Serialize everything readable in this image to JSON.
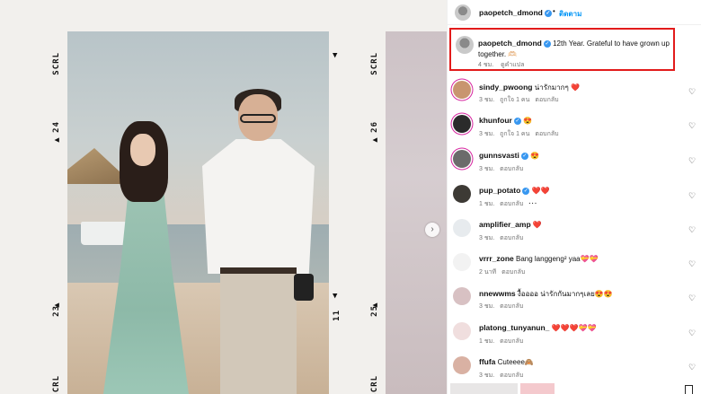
{
  "media": {
    "film_left": {
      "label_top": "SCRL",
      "frame_top": "24",
      "frame_bottom": "23",
      "label_bottom": "SCRL"
    },
    "film_right": {
      "label_top": "SCRL",
      "frame_top": "26",
      "frame_bottom": "25",
      "label_bottom": "SCRL",
      "frame_mid": "11"
    },
    "next_icon": "chevron-right"
  },
  "header": {
    "username": "paopetch_dmond",
    "dot": "•",
    "follow_label": "ติดตาม"
  },
  "caption": {
    "username": "paopetch_dmond",
    "text": "12th Year. Grateful to have grown up together. 🫶🏻",
    "time": "4 ชม.",
    "translate": "ดูคำแปล"
  },
  "comments": [
    {
      "username": "sindy_pwoong",
      "verified": false,
      "text": "น่ารักมากๆ ❤️",
      "time": "3 ชม.",
      "likes": "ถูกใจ 1 คน",
      "reply": "ตอบกลับ",
      "avatar_color": "#c8956f",
      "ring": true
    },
    {
      "username": "khunfour",
      "verified": true,
      "text": "😍",
      "time": "3 ชม.",
      "likes": "ถูกใจ 1 คน",
      "reply": "ตอบกลับ",
      "avatar_color": "#2b2b2b",
      "ring": true
    },
    {
      "username": "gunnsvasti",
      "verified": true,
      "text": "😍",
      "time": "3 ชม.",
      "likes": "",
      "reply": "ตอบกลับ",
      "avatar_color": "#6b6b6b",
      "ring": true
    },
    {
      "username": "pup_potato",
      "verified": true,
      "text": "❤️❤️",
      "time": "1 ชม.",
      "likes": "",
      "reply": "ตอบกลับ",
      "more": "···",
      "avatar_color": "#3d3a35",
      "ring": false
    },
    {
      "username": "amplifier_amp",
      "verified": false,
      "text": "❤️",
      "time": "3 ชม.",
      "likes": "",
      "reply": "ตอบกลับ",
      "avatar_color": "#e7ebee",
      "ring": false
    },
    {
      "username": "vrrr_zone",
      "verified": false,
      "text": "Bang langgeng² yaa💝💝",
      "time": "2 นาที",
      "likes": "",
      "reply": "ตอบกลับ",
      "avatar_color": "#f2f2f2",
      "ring": false
    },
    {
      "username": "nnewwms",
      "verified": false,
      "text": "งื้ออออ น่ารักกันมากๆเลย😍😍",
      "time": "3 ชม.",
      "likes": "",
      "reply": "ตอบกลับ",
      "avatar_color": "#d8c1c3",
      "ring": false
    },
    {
      "username": "platong_tunyanun_",
      "verified": false,
      "text": "❤️❤️❤️💝💝",
      "time": "1 ชม.",
      "likes": "",
      "reply": "ตอบกลับ",
      "avatar_color": "#f0dede",
      "ring": false
    },
    {
      "username": "ffufa",
      "verified": false,
      "text": "Cuteeee🙈",
      "time": "3 ชม.",
      "likes": "",
      "reply": "ตอบกลับ",
      "avatar_color": "#d9b1a3",
      "ring": false
    }
  ],
  "icons": {
    "heart": "heart-icon",
    "verified": "verified-badge-icon",
    "save": "bookmark-icon"
  }
}
